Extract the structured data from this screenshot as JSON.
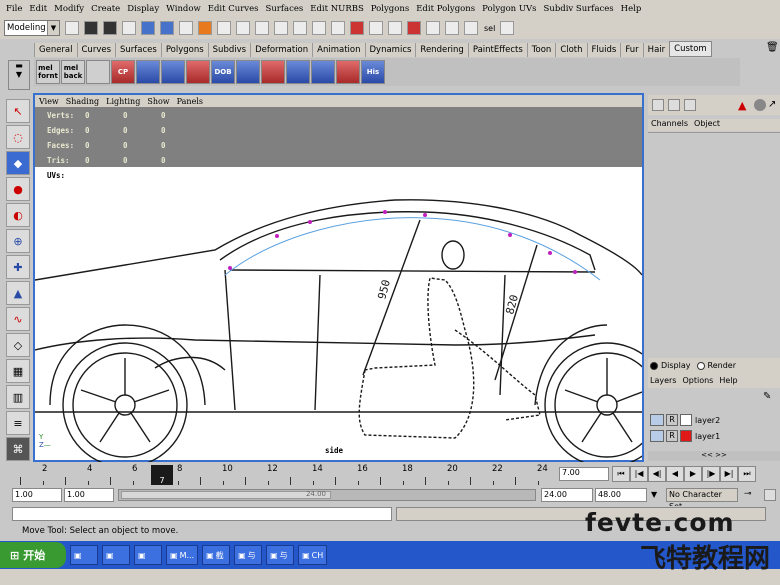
{
  "menu": [
    "File",
    "Edit",
    "Modify",
    "Create",
    "Display",
    "Window",
    "Edit Curves",
    "Surfaces",
    "Edit NURBS",
    "Polygons",
    "Edit Polygons",
    "Polygon UVs",
    "Subdiv Surfaces",
    "Help"
  ],
  "status": {
    "mode": "Modeling",
    "sel_label": "sel"
  },
  "shelf_tabs": [
    "General",
    "Curves",
    "Surfaces",
    "Polygons",
    "Subdivs",
    "Deformation",
    "Animation",
    "Dynamics",
    "Rendering",
    "PaintEffects",
    "Toon",
    "Cloth",
    "Fluids",
    "Fur",
    "Hair",
    "Custom"
  ],
  "active_shelf_tab": "Custom",
  "shelf_buttons": [
    "mel\nfornt",
    "mel\nback",
    "",
    "CP",
    "",
    "",
    "",
    "DOB",
    "",
    "",
    "",
    "",
    "",
    "His"
  ],
  "viewport": {
    "menu": [
      "View",
      "Shading",
      "Lighting",
      "Show",
      "Panels"
    ],
    "hud": [
      {
        "label": "Verts:",
        "v1": "0",
        "v2": "0",
        "v3": "0"
      },
      {
        "label": "Edges:",
        "v1": "0",
        "v2": "0",
        "v3": "0"
      },
      {
        "label": "Faces:",
        "v1": "0",
        "v2": "0",
        "v3": "0"
      },
      {
        "label": "Tris:",
        "v1": "0",
        "v2": "0",
        "v3": "0"
      }
    ],
    "uvs_label": "UVs:",
    "camera_label": "side",
    "dim1": "950",
    "dim2": "820"
  },
  "channel_box": {
    "menu": [
      "Channels",
      "Object"
    ]
  },
  "layers": {
    "display_label": "Display",
    "render_label": "Render",
    "menu": [
      "Layers",
      "Options",
      "Help"
    ],
    "items": [
      {
        "flag": "R",
        "name": "layer2",
        "color": "#ffffff"
      },
      {
        "flag": "R",
        "name": "layer1",
        "color": "#e01818"
      }
    ]
  },
  "timeline": {
    "ticks": [
      "2",
      "4",
      "6",
      "8",
      "10",
      "12",
      "14",
      "16",
      "18",
      "20",
      "22",
      "24"
    ],
    "current_frame": "7",
    "frame_field": "7.00"
  },
  "range": {
    "start": "1.00",
    "inner_start": "1.00",
    "slider_end": "24.00",
    "inner_end": "24.00",
    "end": "48.00",
    "char_set": "No Character Set"
  },
  "help_line": "Move Tool: Select an object to move.",
  "taskbar": {
    "start": "开始",
    "items": [
      "",
      "",
      "",
      "M...",
      "截",
      "与",
      "与",
      "CH"
    ]
  },
  "watermark": {
    "top": "fevte.com",
    "bottom": "飞特教程网"
  }
}
